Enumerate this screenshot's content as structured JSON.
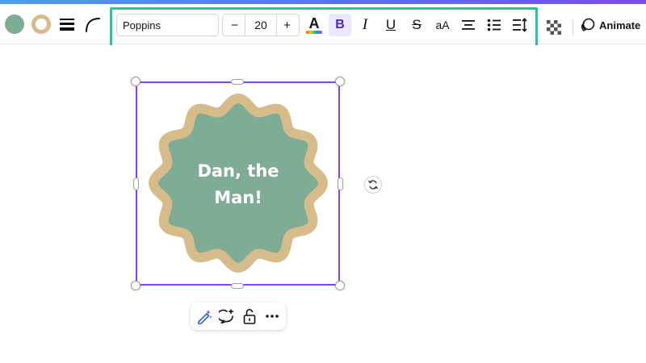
{
  "toolbar": {
    "fill_color": "#7fac95",
    "border_color": "#d6bc8b",
    "font_family": "Poppins",
    "font_size": "20",
    "decrease_label": "−",
    "increase_label": "+",
    "text_color_glyph": "A",
    "bold_glyph": "B",
    "italic_glyph": "I",
    "underline_glyph": "U",
    "strikethrough_glyph": "S",
    "letter_case_glyph": "aA",
    "animate_label": "Animate",
    "highlight_color": "#2fc2a1"
  },
  "canvas": {
    "badge": {
      "text_line1": "Dan, the",
      "text_line2": "Man!",
      "fill_color": "#7fac95",
      "border_color": "#d6bc8b"
    },
    "selection_color": "#8b3dff"
  },
  "icons": {
    "fill": "fill-color-icon",
    "border": "border-style-icon",
    "weight": "border-weight-icon",
    "corner": "corner-rounding-icon",
    "text_color": "text-color-icon",
    "align": "align-center-icon",
    "list": "bullet-list-icon",
    "spacing": "line-spacing-icon",
    "transparency": "transparency-icon",
    "animate": "animate-icon",
    "cursor": "cursor-arrow-icon",
    "rotate": "rotate-icon",
    "magic": "magic-edit-icon",
    "comment": "add-comment-icon",
    "lock": "lock-icon",
    "more": "more-icon"
  }
}
